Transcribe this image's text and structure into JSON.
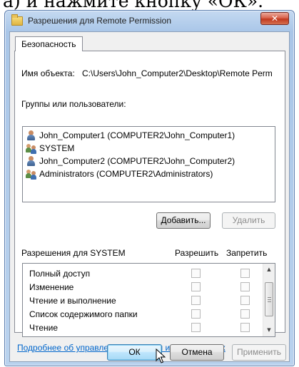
{
  "background_caption": "а) и нажмите кнопку «ОК».",
  "window": {
    "title": "Разрешения для Remote Permission",
    "close_symbol": "✕",
    "folder_icon": "folder-icon"
  },
  "tabs": [
    "Безопасность"
  ],
  "object": {
    "label": "Имя объекта:",
    "path": "C:\\Users\\John_Computer2\\Desktop\\Remote Perm"
  },
  "groups": {
    "label": "Группы или пользователи:",
    "items": [
      {
        "name": "John_Computer1 (COMPUTER2\\John_Computer1)",
        "icon": "user-icon"
      },
      {
        "name": "SYSTEM",
        "icon": "group-icon"
      },
      {
        "name": "John_Computer2 (COMPUTER2\\John_Computer2)",
        "icon": "user-icon"
      },
      {
        "name": "Administrators (COMPUTER2\\Administrators)",
        "icon": "group-icon"
      }
    ]
  },
  "buttons": {
    "add": "Добавить...",
    "remove": "Удалить",
    "ok": "ОК",
    "cancel": "Отмена",
    "apply": "Применить"
  },
  "permissions": {
    "header": "Разрешения для SYSTEM",
    "allow_header": "Разрешить",
    "deny_header": "Запретить",
    "items": [
      {
        "name": "Полный доступ",
        "allow": false,
        "deny": false
      },
      {
        "name": "Изменение",
        "allow": false,
        "deny": false
      },
      {
        "name": "Чтение и выполнение",
        "allow": false,
        "deny": false
      },
      {
        "name": "Список содержимого папки",
        "allow": false,
        "deny": false
      },
      {
        "name": "Чтение",
        "allow": false,
        "deny": false
      }
    ],
    "scroll_up": "▲",
    "scroll_down": "▼"
  },
  "help_link": "Подробнее об управлении доступом и разрешениях"
}
